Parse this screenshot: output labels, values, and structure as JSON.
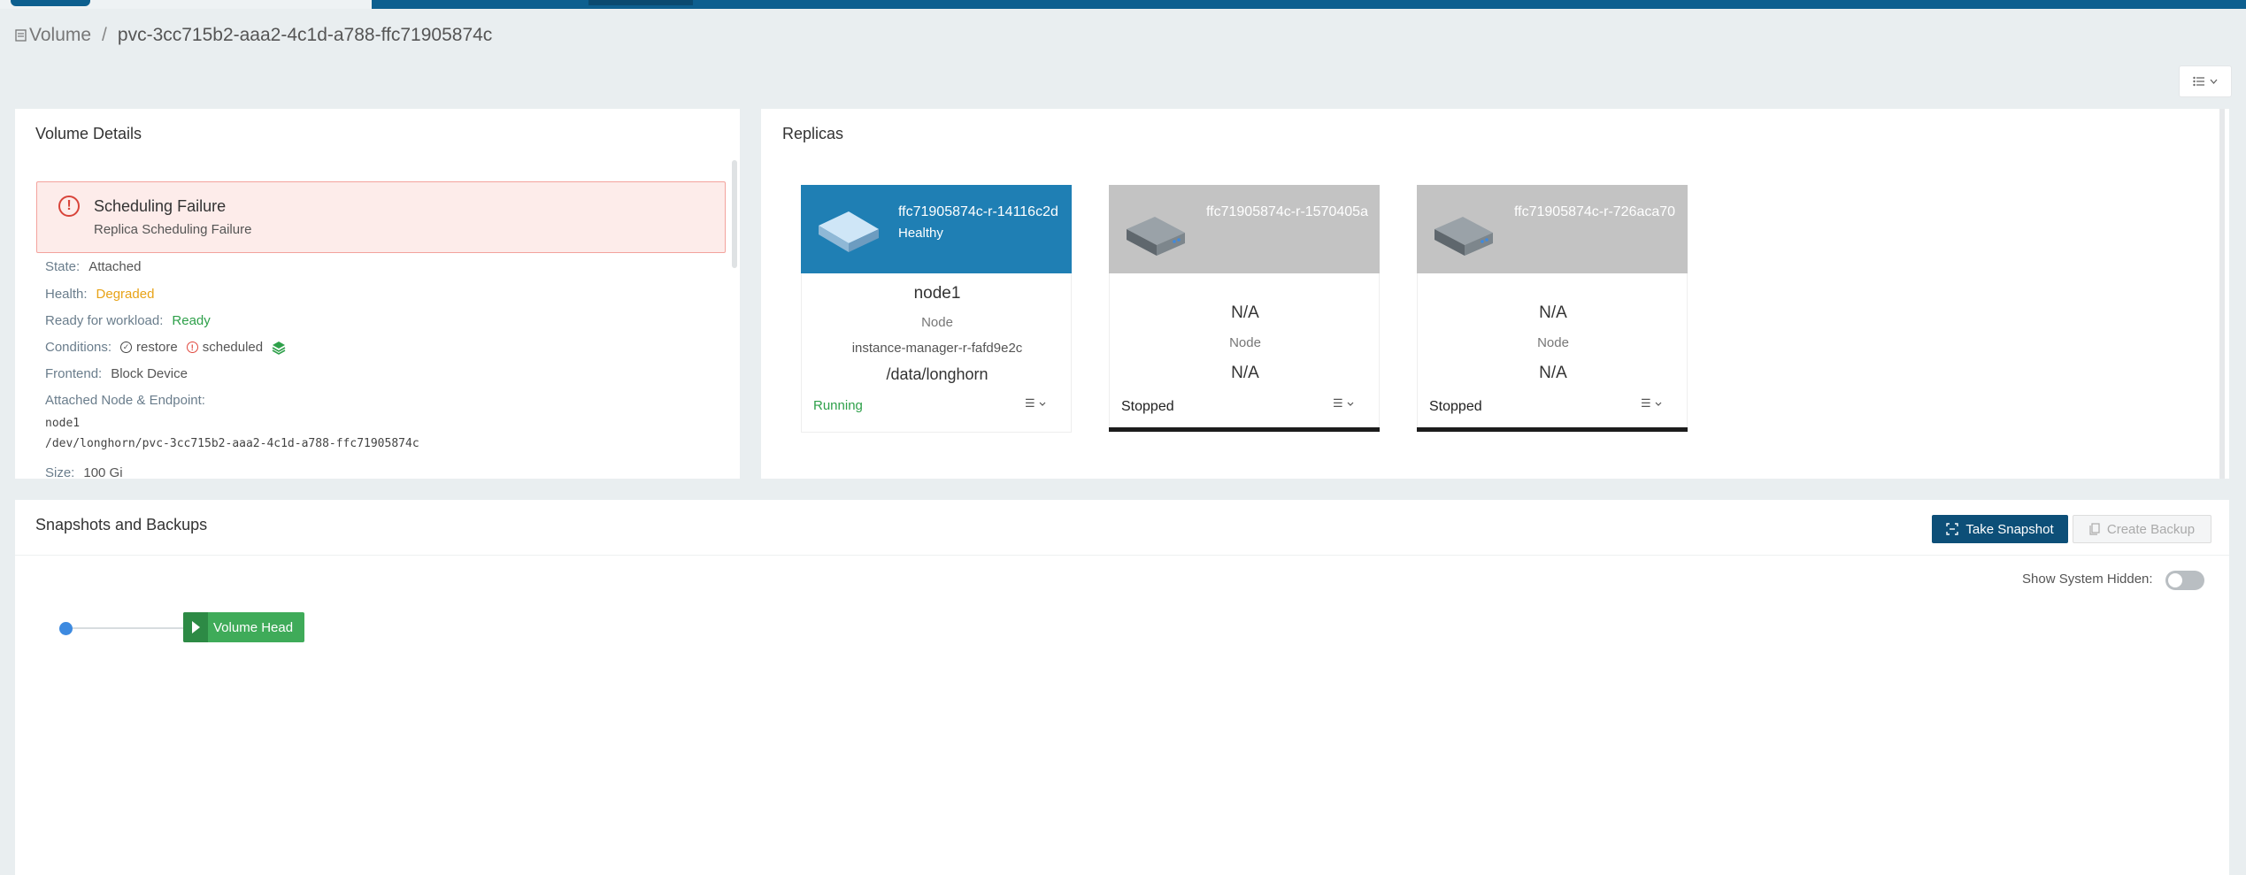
{
  "breadcrumb": {
    "root": "Volume",
    "separator": "/",
    "current": "pvc-3cc715b2-aaa2-4c1d-a788-ffc71905874c"
  },
  "volume_details": {
    "title": "Volume Details",
    "alert": {
      "title": "Scheduling Failure",
      "message": "Replica Scheduling Failure"
    },
    "state": {
      "label": "State:",
      "value": "Attached"
    },
    "health": {
      "label": "Health:",
      "value": "Degraded"
    },
    "ready": {
      "label": "Ready for workload:",
      "value": "Ready"
    },
    "conditions": {
      "label": "Conditions:",
      "restore": "restore",
      "scheduled": "scheduled"
    },
    "frontend": {
      "label": "Frontend:",
      "value": "Block Device"
    },
    "attached": {
      "label": "Attached Node & Endpoint:",
      "node": "node1",
      "endpoint": "/dev/longhorn/pvc-3cc715b2-aaa2-4c1d-a788-ffc71905874c"
    },
    "size": {
      "label": "Size:",
      "value": "100 Gi"
    }
  },
  "replicas": {
    "title": "Replicas",
    "items": [
      {
        "name": "ffc71905874c-r-14116c2d",
        "state": "Healthy",
        "node": "node1",
        "node_label": "Node",
        "instance_manager": "instance-manager-r-fafd9e2c",
        "path": "/data/longhorn",
        "status": "Running"
      },
      {
        "name": "ffc71905874c-r-1570405a",
        "state": "",
        "node": "N/A",
        "node_label": "Node",
        "path": "N/A",
        "status": "Stopped"
      },
      {
        "name": "ffc71905874c-r-726aca70",
        "state": "",
        "node": "N/A",
        "node_label": "Node",
        "path": "N/A",
        "status": "Stopped"
      }
    ]
  },
  "snapshots": {
    "title": "Snapshots and Backups",
    "take_snapshot": "Take Snapshot",
    "create_backup": "Create Backup",
    "show_hidden_label": "Show System Hidden:",
    "show_hidden_on": false,
    "volume_head": "Volume Head"
  },
  "colors": {
    "topbar": "#0d5f8f",
    "replica_healthy": "#1f7fb4",
    "replica_stopped": "#c3c3c3",
    "running": "#2ea04a",
    "degraded": "#e8a317",
    "volume_head": "#3fab59",
    "primary_button": "#0d4f78"
  }
}
